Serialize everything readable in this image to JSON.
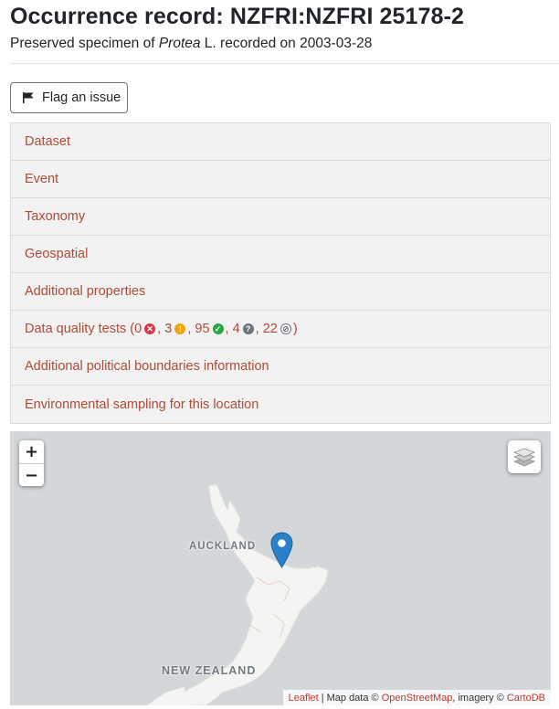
{
  "header": {
    "title": "Occurrence record: NZFRI:NZFRI 25178-2",
    "subtitle_prefix": "Preserved specimen of ",
    "subtitle_taxon": "Protea",
    "subtitle_author": " L.",
    "subtitle_suffix": " recorded on ",
    "recorded_date": "2003-03-28"
  },
  "flag_button": {
    "label": "Flag an issue",
    "icon": "flag-icon"
  },
  "sections": [
    {
      "label": "Dataset"
    },
    {
      "label": "Event"
    },
    {
      "label": "Taxonomy"
    },
    {
      "label": "Geospatial"
    },
    {
      "label": "Additional properties"
    },
    {
      "label": "Data quality tests"
    },
    {
      "label": "Additional political boundaries information"
    },
    {
      "label": "Environmental sampling for this location"
    }
  ],
  "data_quality": {
    "open_paren": " (",
    "close_paren": ")",
    "separator": ", ",
    "failed": "0",
    "warnings": "3",
    "passed": "95",
    "unknown": "4",
    "not_applicable": "22"
  },
  "map": {
    "zoom_in": "+",
    "zoom_out": "−",
    "labels": {
      "auckland": "AUCKLAND",
      "new_zealand": "NEW ZEALAND"
    },
    "layers_icon": "layers-icon",
    "marker_icon": "map-marker-icon",
    "attribution": {
      "leaflet": "Leaflet",
      "sep": " | Map data © ",
      "osm": "OpenStreetMap",
      "imagery": ", imagery © ",
      "carto": "CartoDB"
    }
  },
  "colors": {
    "link": "#b04a35",
    "section_bg": "#f2f2f2",
    "map_water": "#d3d7d9",
    "map_land": "#f5f5f3",
    "marker": "#2a81cb"
  }
}
